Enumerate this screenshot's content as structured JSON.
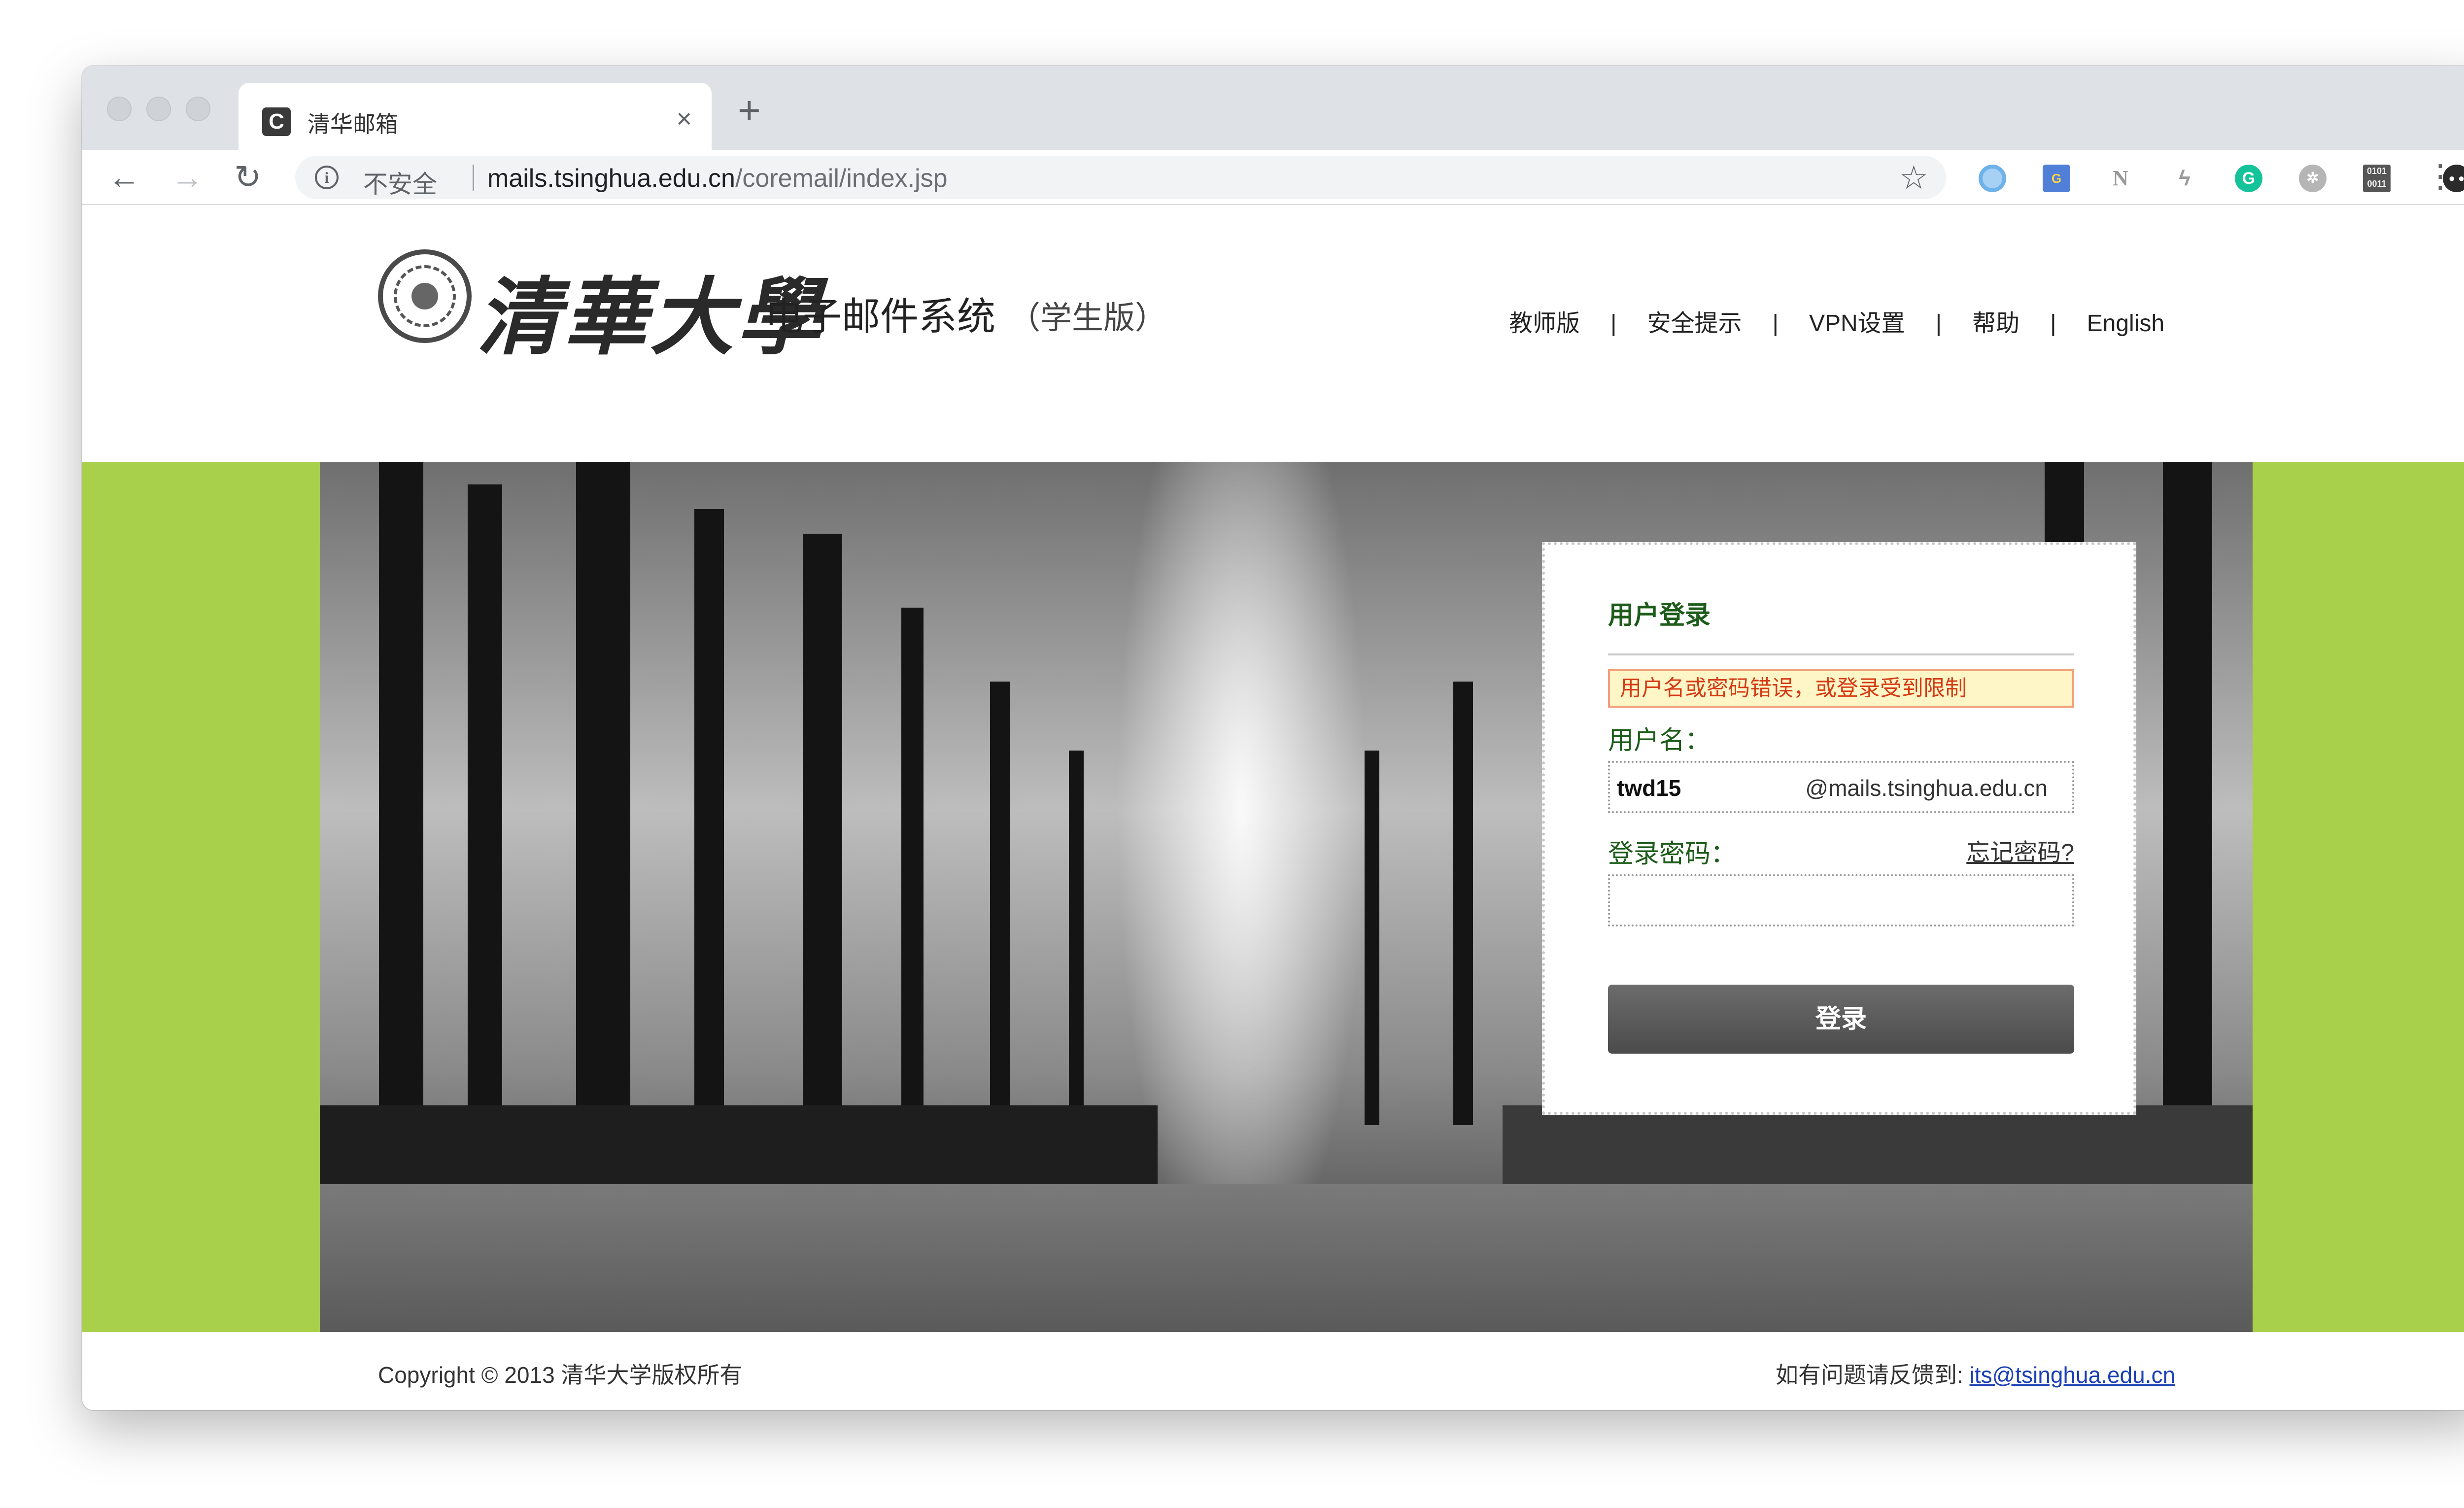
{
  "browser": {
    "tab_title": "清华邮箱",
    "tab_favicon_letter": "C",
    "tab_close": "×",
    "new_tab": "+",
    "back": "←",
    "forward": "→",
    "reload": "↻",
    "info_glyph": "i",
    "insecure_label": "不安全",
    "url_host": "mails.tsinghua.edu.cn",
    "url_path": "/coremail/index.jsp",
    "bookmark_star": "☆",
    "menu": "⋮",
    "extensions": [
      "circle-ext-icon",
      "translate-ext-icon",
      "n-ext-icon",
      "bolt-ext-icon",
      "grammarly-ext-icon",
      "gear-ext-icon",
      "binary-ext-icon",
      "avatar-ext-icon"
    ]
  },
  "header": {
    "logo_calligraphy": "清華大學",
    "system_name": "电子邮件系统",
    "edition": "（学生版）",
    "nav": [
      "教师版",
      "安全提示",
      "VPN设置",
      "帮助",
      "English"
    ],
    "nav_sep": "|"
  },
  "login": {
    "title": "用户登录",
    "error": "用户名或密码错误，或登录受到限制",
    "username_label": "用户名：",
    "username_value": "twd15",
    "domain_suffix": "@mails.tsinghua.edu.cn",
    "password_label": "登录密码：",
    "forgot_link": "忘记密码?",
    "submit": "登录"
  },
  "footer": {
    "copyright": "Copyright © 2013 清华大学版权所有",
    "feedback_prefix": "如有问题请反馈到: ",
    "feedback_email": "its@tsinghua.edu.cn"
  },
  "colors": {
    "brand_green": "#a8d04a",
    "label_green": "#1d5c1a",
    "error_red": "#d43b14",
    "error_bg": "#fff6c7",
    "link_blue": "#1b3fb5"
  }
}
